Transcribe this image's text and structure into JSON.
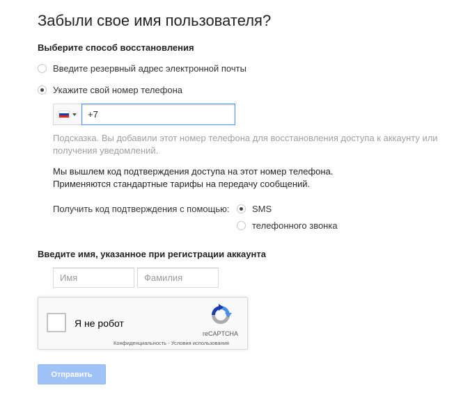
{
  "page": {
    "title": "Забыли свое имя пользователя?"
  },
  "recovery": {
    "heading": "Выберите способ восстановления",
    "options": [
      {
        "label": "Введите резервный адрес электронной почты",
        "selected": false
      },
      {
        "label": "Укажите свой номер телефона",
        "selected": true
      }
    ]
  },
  "phone": {
    "country_flag_colors": [
      "#ffffff",
      "#1c3aa9",
      "#d52b1e"
    ],
    "value": "+7 ",
    "hint": "Подсказка. Вы добавили этот номер телефона для восстановления доступа к аккаунту или получения уведомлений.",
    "info_line1": "Мы вышлем код подтверждения доступа на этот номер телефона.",
    "info_line2": "Применяются стандартные тарифы на передачу сообщений."
  },
  "method": {
    "label": "Получить код подтверждения с помощью:",
    "options": [
      {
        "label": "SMS",
        "selected": true
      },
      {
        "label": "телефонного звонка",
        "selected": false
      }
    ]
  },
  "name": {
    "heading": "Введите имя, указанное при регистрации аккаунта",
    "first_placeholder": "Имя",
    "last_placeholder": "Фамилия"
  },
  "recaptcha": {
    "label": "Я не робот",
    "brand": "reCAPTCHA",
    "privacy": "Конфиденциальность",
    "separator": " - ",
    "terms": "Условия использования",
    "logo_colors": [
      "#1c3aa9",
      "#4a90e2",
      "#ababab"
    ]
  },
  "submit": {
    "label": "Отправить"
  }
}
